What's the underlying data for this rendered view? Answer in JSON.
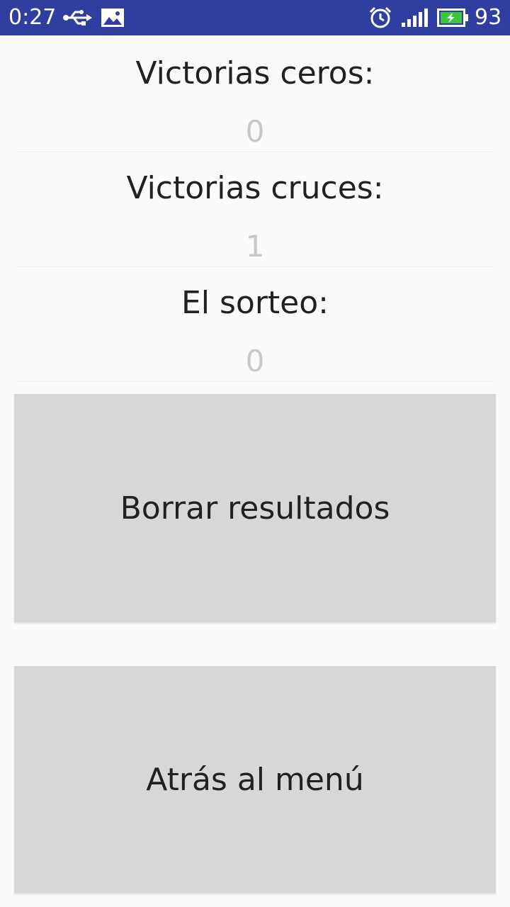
{
  "status_bar": {
    "time": "0:27",
    "battery_level": "93",
    "color": "#303f9f",
    "icons": [
      "usb-icon",
      "image-icon",
      "alarm-icon",
      "signal-icon",
      "battery-charging-icon"
    ]
  },
  "stats": {
    "zeros_label": "Victorias ceros:",
    "zeros_value": "0",
    "crosses_label": "Victorias cruces:",
    "crosses_value": "1",
    "draw_label": "El sorteo:",
    "draw_value": "0"
  },
  "buttons": {
    "clear_label": "Borrar resultados",
    "back_label": "Atrás al menú"
  }
}
